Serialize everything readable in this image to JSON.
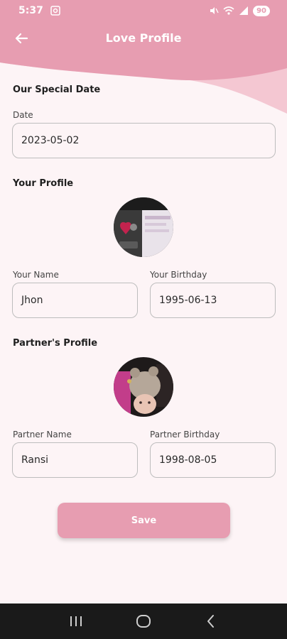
{
  "status_bar": {
    "time": "5:37",
    "battery": "90"
  },
  "header": {
    "title": "Love Profile"
  },
  "special_date": {
    "section_title": "Our Special Date",
    "date_label": "Date",
    "date_value": "2023-05-02"
  },
  "your_profile": {
    "section_title": "Your Profile",
    "name_label": "Your Name",
    "name_value": "Jhon",
    "birthday_label": "Your Birthday",
    "birthday_value": "1995-06-13"
  },
  "partner_profile": {
    "section_title": "Partner's Profile",
    "name_label": "Partner Name",
    "name_value": "Ransi",
    "birthday_label": "Partner Birthday",
    "birthday_value": "1998-08-05"
  },
  "actions": {
    "save_label": "Save"
  },
  "colors": {
    "accent": "#e79db1",
    "accent_light": "#f4c7d2",
    "background": "#fdf4f6"
  },
  "icons": {
    "back": "arrow-left-icon",
    "nav_recent": "recent-apps-icon",
    "nav_home": "home-icon",
    "nav_back": "back-icon"
  }
}
